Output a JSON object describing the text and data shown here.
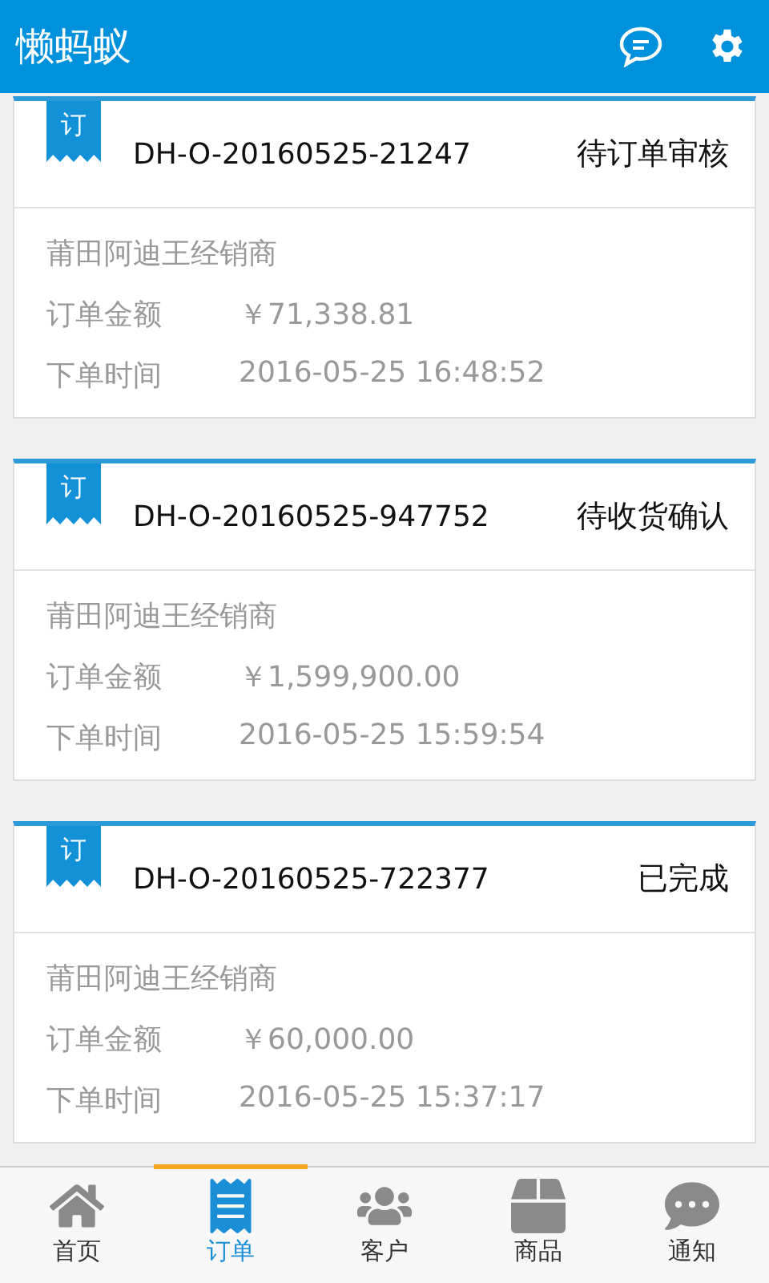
{
  "app_bar": {
    "title": "懒蚂蚁"
  },
  "orders": [
    {
      "badge": "订",
      "number": "DH-O-20160525-21247",
      "status": "待订单审核",
      "dealer": "莆田阿迪王经销商",
      "amount_label": "订单金额",
      "amount": "￥71,338.81",
      "time_label": "下单时间",
      "time": "2016-05-25 16:48:52"
    },
    {
      "badge": "订",
      "number": "DH-O-20160525-947752",
      "status": "待收货确认",
      "dealer": "莆田阿迪王经销商",
      "amount_label": "订单金额",
      "amount": "￥1,599,900.00",
      "time_label": "下单时间",
      "time": "2016-05-25 15:59:54"
    },
    {
      "badge": "订",
      "number": "DH-O-20160525-722377",
      "status": "已完成",
      "dealer": "莆田阿迪王经销商",
      "amount_label": "订单金额",
      "amount": "￥60,000.00",
      "time_label": "下单时间",
      "time": "2016-05-25 15:37:17"
    }
  ],
  "tabs": [
    {
      "kind": "home",
      "label": "首页",
      "selected": false
    },
    {
      "kind": "orders",
      "label": "订单",
      "selected": true
    },
    {
      "kind": "customers",
      "label": "客户",
      "selected": false
    },
    {
      "kind": "products",
      "label": "商品",
      "selected": false
    },
    {
      "kind": "notices",
      "label": "通知",
      "selected": false
    }
  ]
}
